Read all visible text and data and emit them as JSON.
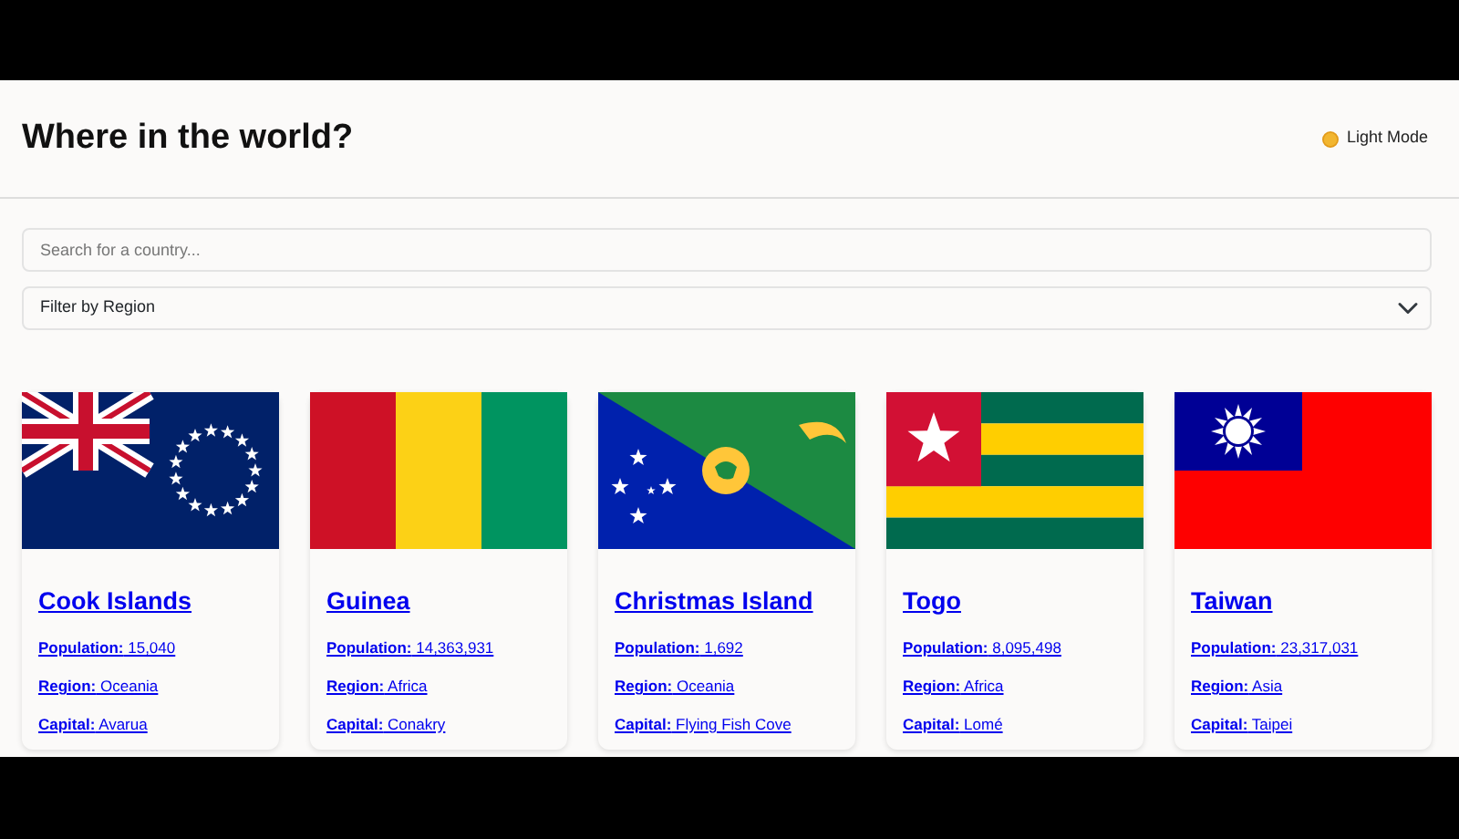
{
  "header": {
    "title": "Where in the world?",
    "theme_toggle": {
      "label": "Light Mode"
    }
  },
  "search": {
    "placeholder": "Search for a country..."
  },
  "region_filter": {
    "value": "Filter by Region"
  },
  "countries": [
    {
      "kind": "cook-islands",
      "name": "Cook Islands",
      "stats": [
        "**Population:** 15,040",
        "**Region:** Oceania",
        "**Capital:** Avarua"
      ]
    },
    {
      "kind": "guinea",
      "name": "Guinea",
      "stats": [
        "**Population:** 14,363,931",
        "**Region:** Africa",
        "**Capital:** Conakry"
      ]
    },
    {
      "kind": "christmas-island",
      "name": "Christmas Island",
      "stats": [
        "**Population:** 1,692",
        "**Region:** Oceania",
        "**Capital:** Flying Fish Cove"
      ]
    },
    {
      "kind": "togo",
      "name": "Togo",
      "stats": [
        "**Population:** 8,095,498",
        "**Region:** Africa",
        "**Capital:** Lomé"
      ]
    },
    {
      "kind": "taiwan",
      "name": "Taiwan",
      "stats": [
        "**Population:** 23,317,031",
        "**Region:** Asia",
        "**Capital:** Taipei"
      ]
    }
  ]
}
